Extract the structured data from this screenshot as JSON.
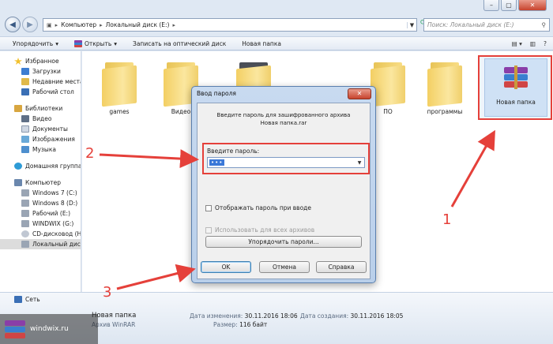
{
  "address": {
    "crumbs": [
      "Компьютер",
      "Локальный диск (E:)"
    ],
    "search_placeholder": "Поиск: Локальный диск (E:)"
  },
  "toolbar": {
    "organize": "Упорядочить",
    "open": "Открыть",
    "burn": "Записать на оптический диск",
    "new_folder": "Новая папка"
  },
  "sidebar": {
    "favorites": "Избранное",
    "downloads": "Загрузки",
    "recent": "Недавние места",
    "desktop": "Рабочий стол",
    "libraries": "Библиотеки",
    "video": "Видео",
    "documents": "Документы",
    "images": "Изображения",
    "music": "Музыка",
    "homegroup": "Домашняя группа",
    "computer": "Компьютер",
    "drive_c": "Windows 7 (C:)",
    "drive_d": "Windows 8 (D:)",
    "drive_e": "Рабочий (E:)",
    "drive_g": "WINDWIX (G:)",
    "drive_h": "CD-дисковод (H",
    "drive_local": "Локальный диск",
    "network": "Сеть"
  },
  "files": [
    {
      "name": "games"
    },
    {
      "name": "Видео"
    },
    {
      "name": "ПО"
    },
    {
      "name": "программы"
    }
  ],
  "rar_file": {
    "name": "Новая папка"
  },
  "status": {
    "name": "Новая папка",
    "type": "Архив WinRAR",
    "modified_label": "Дата изменения:",
    "modified": "30.11.2016 18:06",
    "size_label": "Размер:",
    "size": "116 байт",
    "created_label": "Дата создания:",
    "created": "30.11.2016 18:05"
  },
  "watermark": "windwix.ru",
  "dialog": {
    "title": "Ввод пароля",
    "close": "✕",
    "message_line1": "Введите пароль для зашифрованного архива",
    "message_line2": "Новая папка.rar",
    "password_label": "Введите пароль:",
    "password_value": "•••",
    "show_password": "Отображать пароль при вводе",
    "use_for_all": "Использовать для всех архивов",
    "organize_passwords": "Упорядочить пароли...",
    "ok": "OK",
    "cancel": "Отмена",
    "help": "Справка"
  },
  "annotations": {
    "n1": "1",
    "n2": "2",
    "n3": "3"
  },
  "colors": {
    "annotation": "#e5403a",
    "folder": "#f3cf63",
    "accent": "#3a78d8"
  }
}
